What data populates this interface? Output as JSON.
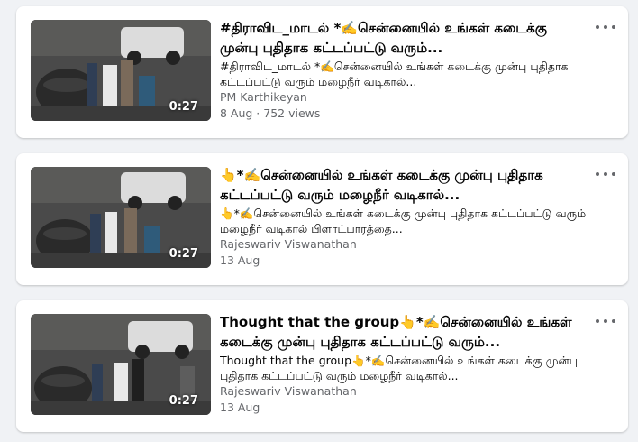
{
  "results": [
    {
      "title": "#திராவிட_மாடல் *✍️சென்னையில் உங்கள் கடைக்கு முன்பு புதிதாக கட்டப்பட்டு வரும்...",
      "description": "#திராவிட_மாடல் *✍️சென்னையில் உங்கள் கடைக்கு முன்பு புதிதாக கட்டப்பட்டு வரும் மழைநீர் வடிகால்...",
      "author": "PM Karthikeyan",
      "meta": "8 Aug · 752 views",
      "duration": "0:27"
    },
    {
      "title": "👆*✍️சென்னையில் உங்கள் கடைக்கு முன்பு புதிதாக கட்டப்பட்டு வரும் மழைநீர் வடிகால்...",
      "description": "👆*✍️சென்னையில் உங்கள் கடைக்கு முன்பு புதிதாக கட்டப்பட்டு வரும் மழைநீர் வடிகால் பிளாட்பாரத்தை...",
      "author": "Rajeswariv Viswanathan",
      "meta": "13 Aug",
      "duration": "0:27"
    },
    {
      "title": "Thought that the group👆*✍️சென்னையில் உங்கள் கடைக்கு முன்பு புதிதாக கட்டப்பட்டு வரும்...",
      "description": "Thought that the group👆*✍️சென்னையில் உங்கள் கடைக்கு முன்பு புதிதாக கட்டப்பட்டு வரும் மழைநீர் வடிகால்...",
      "author": "Rajeswariv Viswanathan",
      "meta": "13 Aug",
      "duration": "0:27"
    }
  ],
  "icons": {
    "more": "more-options-icon"
  },
  "colors": {
    "background": "#f0f2f5",
    "card": "#ffffff",
    "secondary_text": "#65676b"
  }
}
